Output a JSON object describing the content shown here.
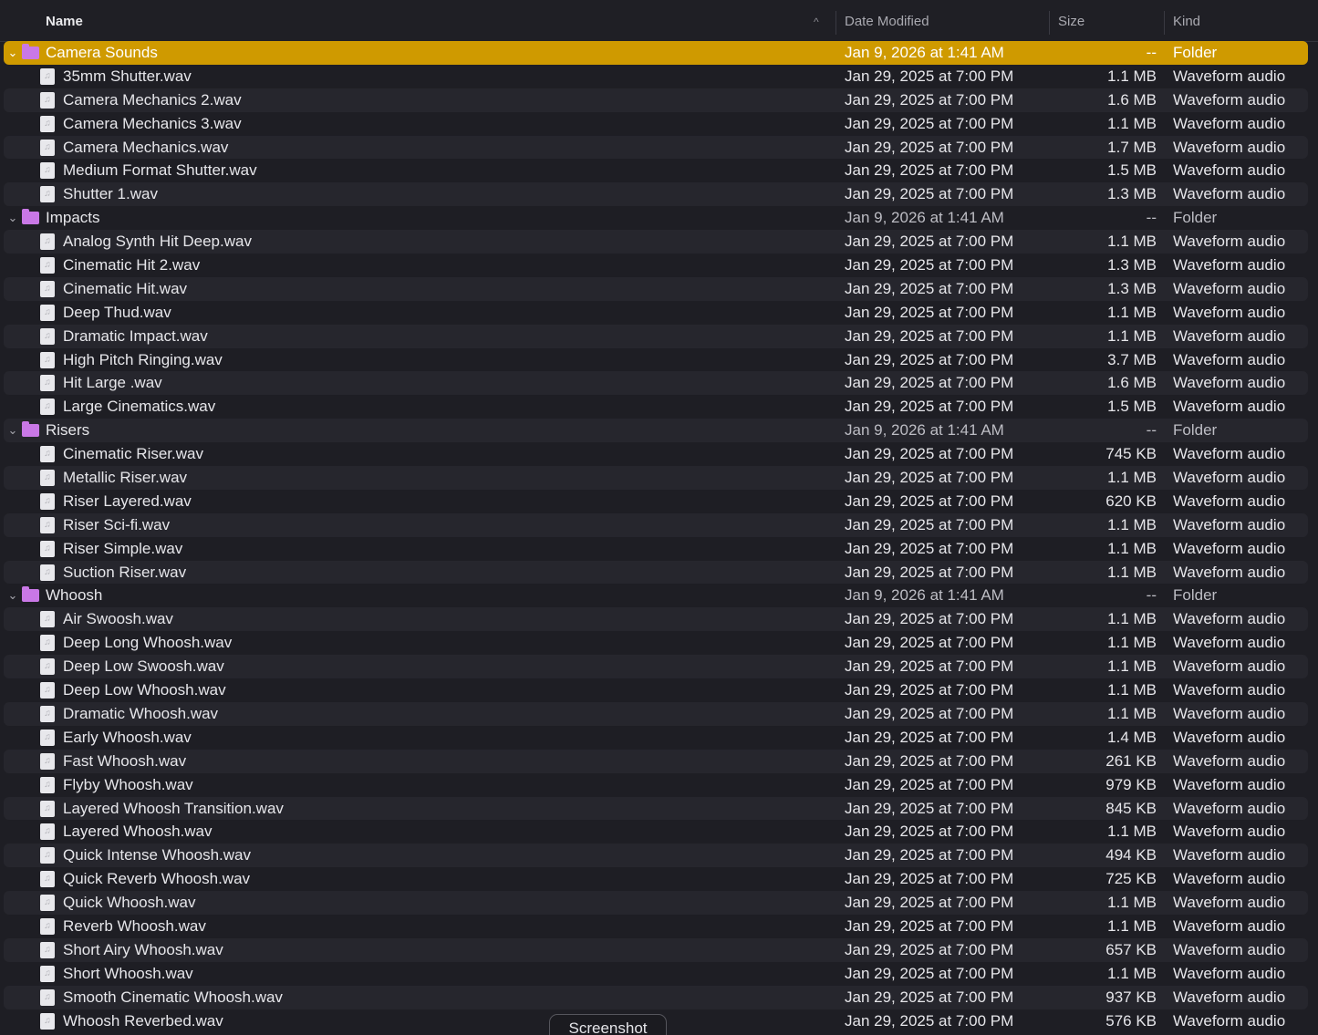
{
  "header": {
    "name": "Name",
    "date_modified": "Date Modified",
    "size": "Size",
    "kind": "Kind",
    "sort_indicator": "^"
  },
  "tooltip": "Screenshot",
  "rows": [
    {
      "type": "folder",
      "name": "Camera Sounds",
      "date": "Jan 9, 2026 at 1:41 AM",
      "size": "--",
      "kind": "Folder",
      "selected": true
    },
    {
      "type": "file",
      "name": "35mm Shutter.wav",
      "date": "Jan 29, 2025 at 7:00 PM",
      "size": "1.1 MB",
      "kind": "Waveform audio"
    },
    {
      "type": "file",
      "name": "Camera Mechanics 2.wav",
      "date": "Jan 29, 2025 at 7:00 PM",
      "size": "1.6 MB",
      "kind": "Waveform audio"
    },
    {
      "type": "file",
      "name": "Camera Mechanics 3.wav",
      "date": "Jan 29, 2025 at 7:00 PM",
      "size": "1.1 MB",
      "kind": "Waveform audio"
    },
    {
      "type": "file",
      "name": "Camera Mechanics.wav",
      "date": "Jan 29, 2025 at 7:00 PM",
      "size": "1.7 MB",
      "kind": "Waveform audio"
    },
    {
      "type": "file",
      "name": "Medium Format Shutter.wav",
      "date": "Jan 29, 2025 at 7:00 PM",
      "size": "1.5 MB",
      "kind": "Waveform audio"
    },
    {
      "type": "file",
      "name": "Shutter 1.wav",
      "date": "Jan 29, 2025 at 7:00 PM",
      "size": "1.3 MB",
      "kind": "Waveform audio"
    },
    {
      "type": "folder",
      "name": "Impacts",
      "date": "Jan 9, 2026 at 1:41 AM",
      "size": "--",
      "kind": "Folder"
    },
    {
      "type": "file",
      "name": "Analog Synth Hit Deep.wav",
      "date": "Jan 29, 2025 at 7:00 PM",
      "size": "1.1 MB",
      "kind": "Waveform audio"
    },
    {
      "type": "file",
      "name": "Cinematic Hit 2.wav",
      "date": "Jan 29, 2025 at 7:00 PM",
      "size": "1.3 MB",
      "kind": "Waveform audio"
    },
    {
      "type": "file",
      "name": "Cinematic Hit.wav",
      "date": "Jan 29, 2025 at 7:00 PM",
      "size": "1.3 MB",
      "kind": "Waveform audio"
    },
    {
      "type": "file",
      "name": "Deep Thud.wav",
      "date": "Jan 29, 2025 at 7:00 PM",
      "size": "1.1 MB",
      "kind": "Waveform audio"
    },
    {
      "type": "file",
      "name": "Dramatic Impact.wav",
      "date": "Jan 29, 2025 at 7:00 PM",
      "size": "1.1 MB",
      "kind": "Waveform audio"
    },
    {
      "type": "file",
      "name": "High Pitch Ringing.wav",
      "date": "Jan 29, 2025 at 7:00 PM",
      "size": "3.7 MB",
      "kind": "Waveform audio"
    },
    {
      "type": "file",
      "name": "Hit Large .wav",
      "date": "Jan 29, 2025 at 7:00 PM",
      "size": "1.6 MB",
      "kind": "Waveform audio"
    },
    {
      "type": "file",
      "name": "Large Cinematics.wav",
      "date": "Jan 29, 2025 at 7:00 PM",
      "size": "1.5 MB",
      "kind": "Waveform audio"
    },
    {
      "type": "folder",
      "name": "Risers",
      "date": "Jan 9, 2026 at 1:41 AM",
      "size": "--",
      "kind": "Folder"
    },
    {
      "type": "file",
      "name": "Cinematic Riser.wav",
      "date": "Jan 29, 2025 at 7:00 PM",
      "size": "745 KB",
      "kind": "Waveform audio"
    },
    {
      "type": "file",
      "name": "Metallic Riser.wav",
      "date": "Jan 29, 2025 at 7:00 PM",
      "size": "1.1 MB",
      "kind": "Waveform audio"
    },
    {
      "type": "file",
      "name": "Riser Layered.wav",
      "date": "Jan 29, 2025 at 7:00 PM",
      "size": "620 KB",
      "kind": "Waveform audio"
    },
    {
      "type": "file",
      "name": "Riser Sci-fi.wav",
      "date": "Jan 29, 2025 at 7:00 PM",
      "size": "1.1 MB",
      "kind": "Waveform audio"
    },
    {
      "type": "file",
      "name": "Riser Simple.wav",
      "date": "Jan 29, 2025 at 7:00 PM",
      "size": "1.1 MB",
      "kind": "Waveform audio"
    },
    {
      "type": "file",
      "name": "Suction Riser.wav",
      "date": "Jan 29, 2025 at 7:00 PM",
      "size": "1.1 MB",
      "kind": "Waveform audio"
    },
    {
      "type": "folder",
      "name": "Whoosh",
      "date": "Jan 9, 2026 at 1:41 AM",
      "size": "--",
      "kind": "Folder"
    },
    {
      "type": "file",
      "name": "Air Swoosh.wav",
      "date": "Jan 29, 2025 at 7:00 PM",
      "size": "1.1 MB",
      "kind": "Waveform audio"
    },
    {
      "type": "file",
      "name": "Deep Long Whoosh.wav",
      "date": "Jan 29, 2025 at 7:00 PM",
      "size": "1.1 MB",
      "kind": "Waveform audio"
    },
    {
      "type": "file",
      "name": "Deep Low Swoosh.wav",
      "date": "Jan 29, 2025 at 7:00 PM",
      "size": "1.1 MB",
      "kind": "Waveform audio"
    },
    {
      "type": "file",
      "name": "Deep Low Whoosh.wav",
      "date": "Jan 29, 2025 at 7:00 PM",
      "size": "1.1 MB",
      "kind": "Waveform audio"
    },
    {
      "type": "file",
      "name": "Dramatic Whoosh.wav",
      "date": "Jan 29, 2025 at 7:00 PM",
      "size": "1.1 MB",
      "kind": "Waveform audio"
    },
    {
      "type": "file",
      "name": "Early Whoosh.wav",
      "date": "Jan 29, 2025 at 7:00 PM",
      "size": "1.4 MB",
      "kind": "Waveform audio"
    },
    {
      "type": "file",
      "name": "Fast Whoosh.wav",
      "date": "Jan 29, 2025 at 7:00 PM",
      "size": "261 KB",
      "kind": "Waveform audio"
    },
    {
      "type": "file",
      "name": "Flyby Whoosh.wav",
      "date": "Jan 29, 2025 at 7:00 PM",
      "size": "979 KB",
      "kind": "Waveform audio"
    },
    {
      "type": "file",
      "name": "Layered Whoosh Transition.wav",
      "date": "Jan 29, 2025 at 7:00 PM",
      "size": "845 KB",
      "kind": "Waveform audio"
    },
    {
      "type": "file",
      "name": "Layered Whoosh.wav",
      "date": "Jan 29, 2025 at 7:00 PM",
      "size": "1.1 MB",
      "kind": "Waveform audio"
    },
    {
      "type": "file",
      "name": "Quick Intense Whoosh.wav",
      "date": "Jan 29, 2025 at 7:00 PM",
      "size": "494 KB",
      "kind": "Waveform audio"
    },
    {
      "type": "file",
      "name": "Quick Reverb Whoosh.wav",
      "date": "Jan 29, 2025 at 7:00 PM",
      "size": "725 KB",
      "kind": "Waveform audio"
    },
    {
      "type": "file",
      "name": "Quick Whoosh.wav",
      "date": "Jan 29, 2025 at 7:00 PM",
      "size": "1.1 MB",
      "kind": "Waveform audio"
    },
    {
      "type": "file",
      "name": "Reverb Whoosh.wav",
      "date": "Jan 29, 2025 at 7:00 PM",
      "size": "1.1 MB",
      "kind": "Waveform audio"
    },
    {
      "type": "file",
      "name": "Short Airy Whoosh.wav",
      "date": "Jan 29, 2025 at 7:00 PM",
      "size": "657 KB",
      "kind": "Waveform audio"
    },
    {
      "type": "file",
      "name": "Short Whoosh.wav",
      "date": "Jan 29, 2025 at 7:00 PM",
      "size": "1.1 MB",
      "kind": "Waveform audio"
    },
    {
      "type": "file",
      "name": "Smooth Cinematic Whoosh.wav",
      "date": "Jan 29, 2025 at 7:00 PM",
      "size": "937 KB",
      "kind": "Waveform audio"
    },
    {
      "type": "file",
      "name": "Whoosh Reverbed.wav",
      "date": "Jan 29, 2025 at 7:00 PM",
      "size": "576 KB",
      "kind": "Waveform audio"
    }
  ],
  "colors": {
    "background": "#1e1e24",
    "alt_row": "#26262d",
    "selection": "#cf9a00",
    "folder_icon": "#c978e6"
  },
  "icons": {
    "folder": "folder-icon",
    "file": "audio-file-icon",
    "disclosure": "chevron-down-icon",
    "sort": "sort-ascending-icon"
  }
}
